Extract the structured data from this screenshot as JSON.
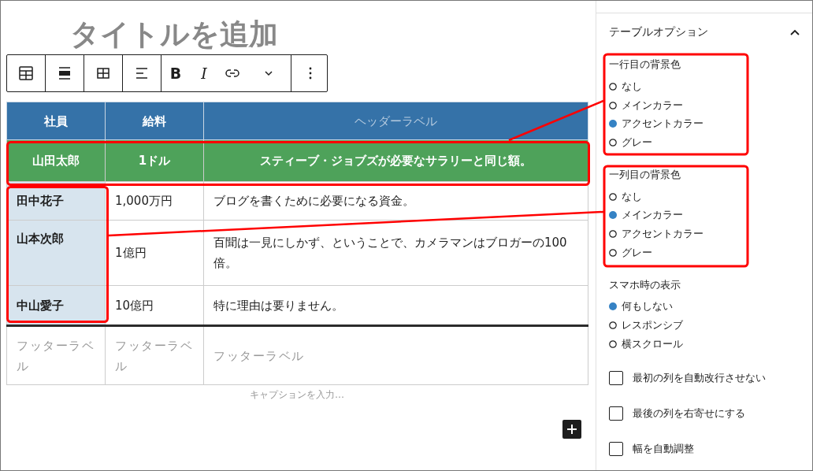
{
  "title": "タイトルを追加",
  "toolbar": {
    "format_buttons": [
      "B",
      "I"
    ]
  },
  "table": {
    "columns": [
      {
        "label": "社員"
      },
      {
        "label": "給料"
      },
      {
        "placeholder": "ヘッダーラベル"
      }
    ],
    "rows": [
      [
        "山田太郎",
        "1ドル",
        "スティーブ・ジョブズが必要なサラリーと同じ額。"
      ],
      [
        "田中花子",
        "1,000万円",
        "ブログを書くために必要になる資金。"
      ],
      [
        "山本次郎",
        "1億円",
        "百聞は一見にしかず、ということで、カメラマンはブロガーの100倍。"
      ],
      [
        "中山愛子",
        "10億円",
        "特に理由は要りません。"
      ]
    ],
    "footer": [
      {
        "placeholder": "フッターラベル"
      },
      {
        "placeholder": "フッターラベル"
      },
      {
        "placeholder": "フッターラベル"
      }
    ],
    "caption_placeholder": "キャプションを入力…"
  },
  "sidebar": {
    "panel_title": "テーブルオプション",
    "expanded": true,
    "groups": [
      {
        "label": "一行目の背景色",
        "options": [
          {
            "label": "なし",
            "selected": false
          },
          {
            "label": "メインカラー",
            "selected": false
          },
          {
            "label": "アクセントカラー",
            "selected": true
          },
          {
            "label": "グレー",
            "selected": false
          }
        ]
      },
      {
        "label": "一列目の背景色",
        "options": [
          {
            "label": "なし",
            "selected": false
          },
          {
            "label": "メインカラー",
            "selected": true
          },
          {
            "label": "アクセントカラー",
            "selected": false
          },
          {
            "label": "グレー",
            "selected": false
          }
        ]
      },
      {
        "label": "スマホ時の表示",
        "options": [
          {
            "label": "何もしない",
            "selected": true
          },
          {
            "label": "レスポンシブ",
            "selected": false
          },
          {
            "label": "横スクロール",
            "selected": false
          }
        ]
      }
    ],
    "checkboxes": [
      {
        "label": "最初の列を自動改行させない",
        "checked": false
      },
      {
        "label": "最後の列を右寄せにする",
        "checked": false
      },
      {
        "label": "幅を自動調整",
        "checked": false
      }
    ]
  }
}
